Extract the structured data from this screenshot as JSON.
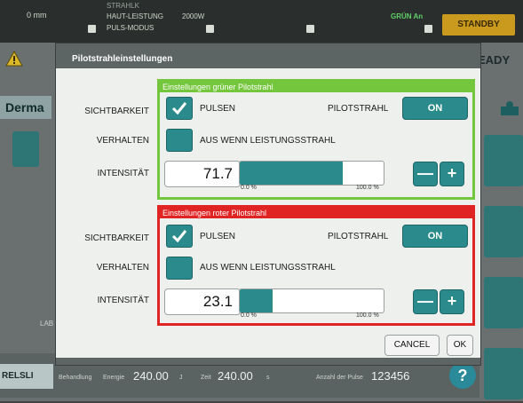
{
  "topbar": {
    "distance": "0 mm",
    "status_labels": [
      "STRAHLK",
      "HAUT-LEISTUNG",
      "PULS-MODUS"
    ],
    "power": "2000W",
    "laser_state": "GRÜN An",
    "standby_label": "STANDBY"
  },
  "background": {
    "ready_label": "EADY",
    "derma_label": "Derma",
    "left_label": "LAB",
    "release_label": "RELSLI"
  },
  "bottombar": {
    "treatment_label": "Behandlung",
    "energy_label": "Energie",
    "energy_value": "240.00",
    "energy_unit": "J",
    "time_label": "Zeit",
    "time_value": "240.00",
    "time_unit": "s",
    "pulses_label": "Anzahl der Pulse",
    "pulses_value": "123456",
    "help_label": "?"
  },
  "dialog": {
    "title": "Pilotstrahleinstellungen",
    "labels": {
      "visibility": "SICHTBARKEIT",
      "behavior": "VERHALTEN",
      "intensity": "INTENSITÄT"
    },
    "green": {
      "header": "Einstellungen grüner Pilotstrahl",
      "pulse_label": "PULSEN",
      "pulse_checked": true,
      "pilot_label": "PILOTSTRAHL",
      "pilot_button": "ON",
      "behavior_option": "AUS WENN LEISTUNGSSTRAHL",
      "behavior_checked": false,
      "intensity_value": "71.7",
      "intensity_percent": 71.7,
      "range_min": "0.0 %",
      "range_max": "100.0 %",
      "minus_label": "—",
      "plus_label": "+"
    },
    "red": {
      "header": "Einstellungen roter Pilotstrahl",
      "pulse_label": "PULSEN",
      "pulse_checked": true,
      "pilot_label": "PILOTSTRAHL",
      "pilot_button": "ON",
      "behavior_option": "AUS WENN LEISTUNGSSTRAHL",
      "behavior_checked": false,
      "intensity_value": "23.1",
      "intensity_percent": 23.1,
      "range_min": "0.0 %",
      "range_max": "100.0 %",
      "minus_label": "—",
      "plus_label": "+"
    },
    "cancel_label": "CANCEL",
    "ok_label": "OK"
  },
  "colors": {
    "accent": "#2b8a8c",
    "green_group": "#74c63c",
    "red_group": "#e02424",
    "standby": "#c99a1e"
  }
}
